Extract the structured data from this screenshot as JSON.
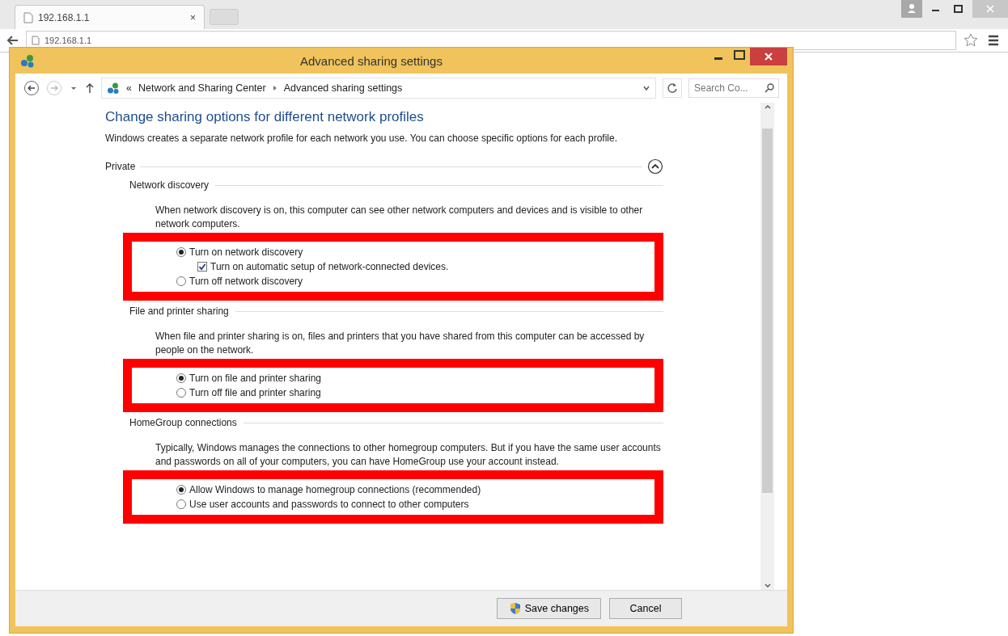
{
  "browser": {
    "tabs": [
      {
        "title": "192.168.1.1",
        "close": "×",
        "selected": true
      }
    ],
    "address": "192.168.1.1"
  },
  "window": {
    "title": "Advanced sharing settings"
  },
  "nav": {
    "breadcrumb_prefix": "«",
    "breadcrumb": [
      "Network and Sharing Center",
      "Advanced sharing settings"
    ],
    "search": {
      "placeholder": "Search Co..."
    }
  },
  "content": {
    "heading": "Change sharing options for different network profiles",
    "intro": "Windows creates a separate network profile for each network you use. You can choose specific options for each profile.",
    "profile": {
      "label": "Private",
      "expanded": true,
      "sections": [
        {
          "title": "Network discovery",
          "description": "When network discovery is on, this computer can see other network computers and devices and is visible to other network computers.",
          "highlighted": true,
          "options": [
            {
              "kind": "radio",
              "label": "Turn on network discovery",
              "selected": true
            },
            {
              "kind": "checkbox",
              "label": "Turn on automatic setup of network-connected devices.",
              "checked": true
            },
            {
              "kind": "radio",
              "label": "Turn off network discovery",
              "selected": false
            }
          ]
        },
        {
          "title": "File and printer sharing",
          "description": "When file and printer sharing is on, files and printers that you have shared from this computer can be accessed by people on the network.",
          "highlighted": true,
          "options": [
            {
              "kind": "radio",
              "label": "Turn on file and printer sharing",
              "selected": true
            },
            {
              "kind": "radio",
              "label": "Turn off file and printer sharing",
              "selected": false
            }
          ]
        },
        {
          "title": "HomeGroup connections",
          "description": "Typically, Windows manages the connections to other homegroup computers. But if you have the same user accounts and passwords on all of your computers, you can have HomeGroup use your account instead.",
          "highlighted": true,
          "options": [
            {
              "kind": "radio",
              "label": "Allow Windows to manage homegroup connections (recommended)",
              "selected": true
            },
            {
              "kind": "radio",
              "label": "Use user accounts and passwords to connect to other computers",
              "selected": false
            }
          ]
        }
      ]
    }
  },
  "buttons": [
    {
      "kind": "shield",
      "label": "Save changes"
    },
    {
      "kind": "plain",
      "label": "Cancel"
    }
  ]
}
